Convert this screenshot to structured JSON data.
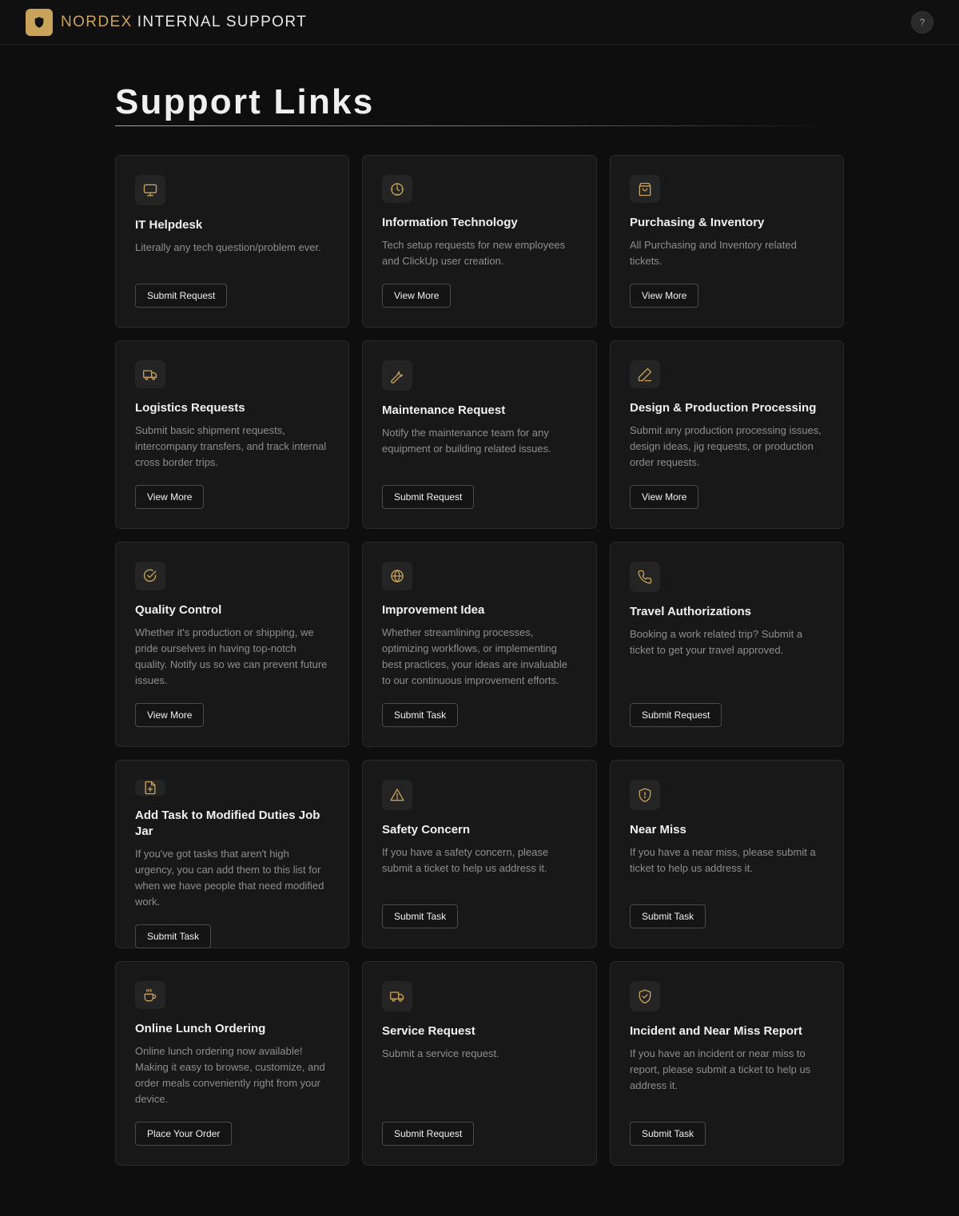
{
  "header": {
    "brand_accent": "NORDEX",
    "brand_rest": "INTERNAL SUPPORT",
    "help_label": "?",
    "logo_icon": "shield-icon"
  },
  "page": {
    "title": "Support Links"
  },
  "colors": {
    "accent": "#c9a35a",
    "background": "#0e0e0e",
    "card": "#181818"
  },
  "cards": [
    {
      "icon": "monitor-icon",
      "title": "IT Helpdesk",
      "desc": "Literally any tech question/problem ever.",
      "button": "Submit Request"
    },
    {
      "icon": "clock-icon",
      "title": "Information Technology",
      "desc": "Tech setup requests for new employees and ClickUp user creation.",
      "button": "View More"
    },
    {
      "icon": "shopping-bag-icon",
      "title": "Purchasing & Inventory",
      "desc": "All Purchasing and Inventory related tickets.",
      "button": "View More"
    },
    {
      "icon": "truck-icon",
      "title": "Logistics Requests",
      "desc": "Submit basic shipment requests, intercompany transfers, and track internal cross border trips.",
      "button": "View More"
    },
    {
      "icon": "wrench-icon",
      "title": "Maintenance Request",
      "desc": "Notify the maintenance team for any equipment or building related issues.",
      "button": "Submit Request"
    },
    {
      "icon": "pen-icon",
      "title": "Design & Production Processing",
      "desc": "Submit any production processing issues, design ideas, jig requests, or production order requests.",
      "button": "View More"
    },
    {
      "icon": "check-circle-icon",
      "title": "Quality Control",
      "desc": "Whether it's production or shipping, we pride ourselves in having top-notch quality. Notify us so we can prevent future issues.",
      "button": "View More"
    },
    {
      "icon": "globe-icon",
      "title": "Improvement Idea",
      "desc": "Whether streamlining processes, optimizing workflows, or implementing best practices, your ideas are invaluable to our continuous improvement efforts.",
      "button": "Submit Task"
    },
    {
      "icon": "phone-icon",
      "title": "Travel Authorizations",
      "desc": "Booking a work related trip? Submit a ticket to get your travel approved.",
      "button": "Submit Request"
    },
    {
      "icon": "file-plus-icon",
      "title": "Add Task to Modified Duties Job Jar",
      "desc": "If you've got tasks that aren't high urgency, you can add them to this list for when we have people that need modified work.",
      "button": "Submit Task"
    },
    {
      "icon": "warning-triangle-icon",
      "title": "Safety Concern",
      "desc": "If you have a safety concern, please submit a ticket to help us address it.",
      "button": "Submit Task"
    },
    {
      "icon": "shield-alert-icon",
      "title": "Near Miss",
      "desc": "If you have a near miss, please submit a ticket to help us address it.",
      "button": "Submit Task"
    },
    {
      "icon": "coffee-icon",
      "title": "Online Lunch Ordering",
      "desc": "Online lunch ordering now available! Making it easy to browse, customize, and order meals conveniently right from your device.",
      "button": "Place Your Order"
    },
    {
      "icon": "truck-icon",
      "title": "Service Request",
      "desc": "Submit a service request.",
      "button": "Submit Request"
    },
    {
      "icon": "shield-check-icon",
      "title": "Incident and Near Miss Report",
      "desc": "If you have an incident or near miss to report, please submit a ticket to help us address it.",
      "button": "Submit Task"
    }
  ]
}
